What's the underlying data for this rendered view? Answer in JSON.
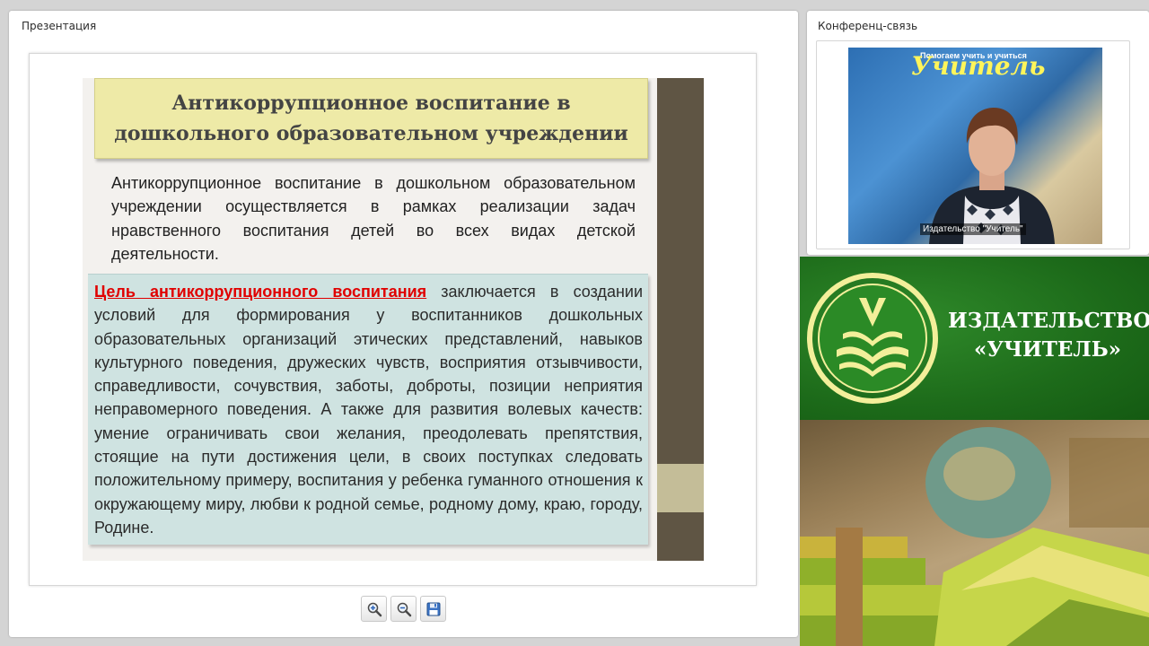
{
  "presentation": {
    "panel_title": "Презентация",
    "slide": {
      "title": "Антикоррупционное воспитание в дошкольного образовательном учреждении",
      "intro": "Антикоррупционное воспитание в дошкольном образовательном учреждении осуществляется в рамках реализации задач нравственного воспитания детей во всех видах детской деятельности.",
      "goal_highlight": "Цель антикоррупционного воспитания",
      "goal_text": " заключается в создании условий для формирования у воспитанников дошкольных образовательных организаций этических представлений, навыков культурного поведения, дружеских чувств, восприятия отзывчивости, справедливости, сочувствия, заботы, доброты, позиции неприятия неправомерного поведения. А также для развития волевых качеств: умение ограничивать свои желания, преодолевать препятствия, стоящие на пути достижения цели, в своих поступках следовать положительному примеру, воспитания у ребенка гуманного отношения к окружающему миру, любви к родной семье, родному дому, краю, городу, Родине."
    },
    "toolbar": {
      "zoom_in_icon": "zoom-in-icon",
      "zoom_out_icon": "zoom-out-icon",
      "save_icon": "save-icon"
    }
  },
  "conference": {
    "panel_title": "Конференц-связь",
    "video": {
      "banner_tagline": "Помогаем учить и учиться",
      "banner_brand": "Учитель",
      "caption": "Издательство \"Учитель\""
    }
  },
  "publisher": {
    "name_line1": "ИЗДАТЕЛЬСТВО",
    "name_line2": "«УЧИТЕЛЬ»"
  },
  "colors": {
    "title_box": "#eeeaa7",
    "goal_box": "#cfe3e1",
    "goal_highlight": "#e00000",
    "slide_sidebar": "#5f5544",
    "publisher_green": "#1d6b1a"
  }
}
